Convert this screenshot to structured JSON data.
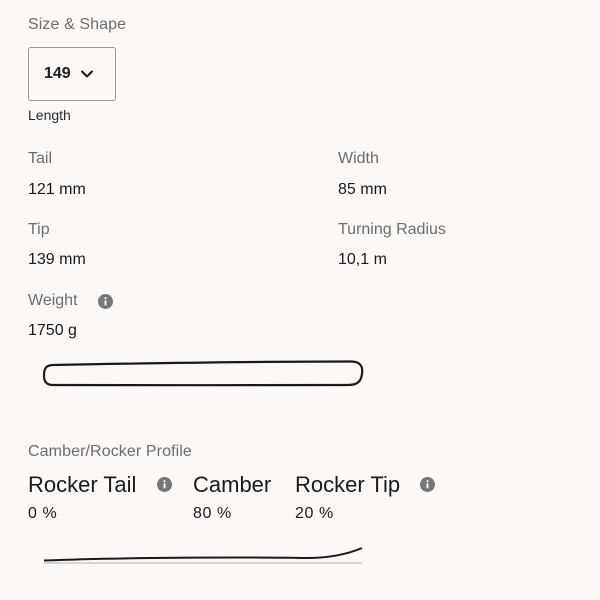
{
  "size_shape": {
    "title": "Size & Shape",
    "length_select": {
      "value": "149",
      "caption": "Length"
    }
  },
  "specs": {
    "tail": {
      "label": "Tail",
      "value": "121 mm"
    },
    "width": {
      "label": "Width",
      "value": "85 mm"
    },
    "tip": {
      "label": "Tip",
      "value": "139 mm"
    },
    "turning_radius": {
      "label": "Turning Radius",
      "value": "10,1 m"
    },
    "weight": {
      "label": "Weight",
      "value": "1750 g"
    }
  },
  "profile": {
    "title": "Camber/Rocker Profile",
    "items": [
      {
        "label": "Rocker Tail",
        "value": "0 %",
        "info": true
      },
      {
        "label": "Camber",
        "value": "80 %",
        "info": false
      },
      {
        "label": "Rocker Tip",
        "value": "20 %",
        "info": true
      }
    ]
  },
  "icons": {
    "chevron": "chevron-down-icon",
    "info": "info-icon"
  },
  "colors": {
    "background": "#fcf8f6",
    "muted_text": "#6d6d6d",
    "text": "#1a1a1a",
    "icon": "#777777"
  }
}
